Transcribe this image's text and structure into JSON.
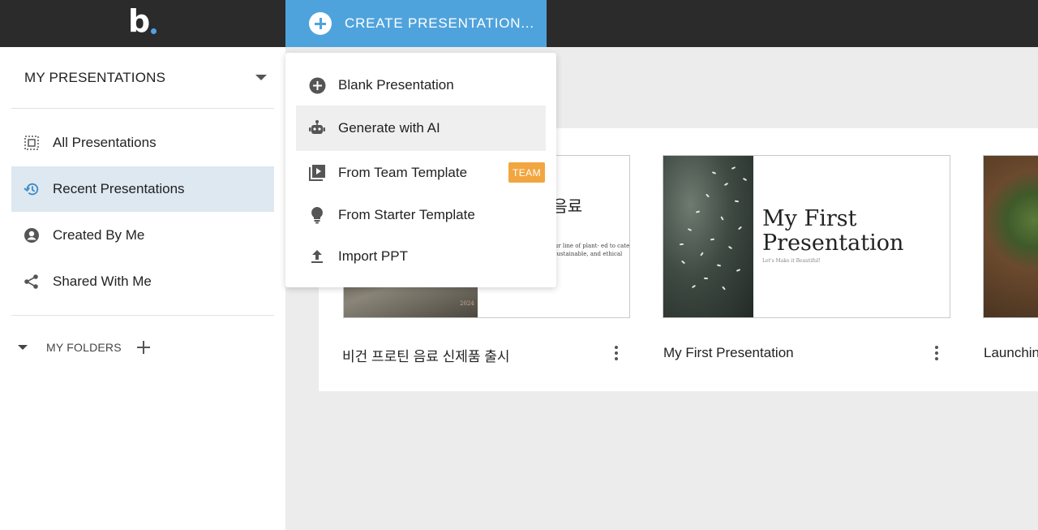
{
  "topbar": {
    "logo_letter": "b",
    "create_button_label": "CREATE PRESENTATION..."
  },
  "sidebar": {
    "header_title": "MY PRESENTATIONS",
    "items": [
      {
        "label": "All Presentations",
        "icon": "grid-select-icon"
      },
      {
        "label": "Recent Presentations",
        "icon": "history-icon",
        "active": true
      },
      {
        "label": "Created By Me",
        "icon": "user-circle-icon"
      },
      {
        "label": "Shared With Me",
        "icon": "share-icon"
      }
    ],
    "folders_label": "MY FOLDERS"
  },
  "menu": {
    "items": [
      {
        "label": "Blank Presentation",
        "icon": "plus-circle-icon"
      },
      {
        "label": "Generate with AI",
        "icon": "robot-icon"
      },
      {
        "label": "From Team Template",
        "icon": "template-play-icon",
        "badge": "TEAM"
      },
      {
        "label": "From Starter Template",
        "icon": "lightbulb-icon"
      },
      {
        "label": "Import PPT",
        "icon": "upload-icon"
      }
    ]
  },
  "presentations": [
    {
      "title": "비건 프로틴 음료 신제품 출시",
      "thumb_title_lines": [
        "! 음료",
        "ǀ"
      ],
      "thumb_body": "ns to our line of plant- ed to cater to the sustainable, and ethical",
      "thumb_photo_text": "2024"
    },
    {
      "title": "My First Presentation",
      "thumb_title_lines": [
        "My First",
        "Presentation"
      ],
      "thumb_subtitle": "Let's Make it Beautiful!"
    },
    {
      "title": "Launchin"
    }
  ],
  "colors": {
    "topbar": "#2b2b2b",
    "accent": "#4fa3dc",
    "active_nav": "#dde8f0",
    "team_badge": "#f2a640"
  }
}
